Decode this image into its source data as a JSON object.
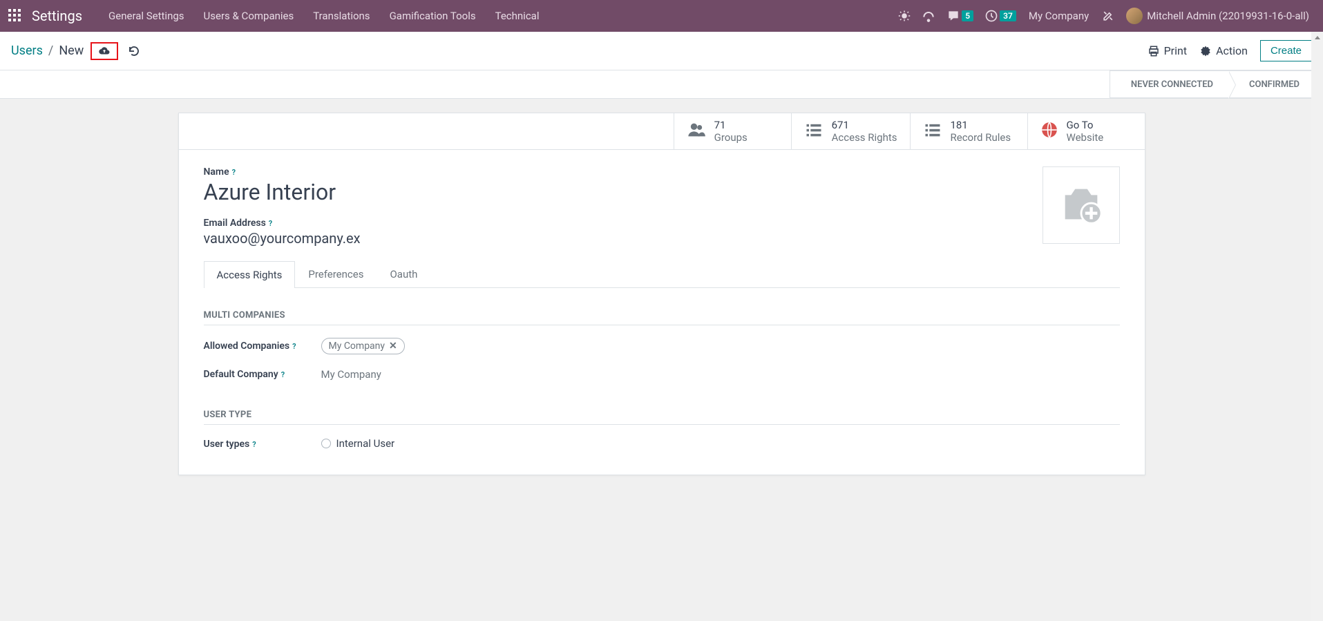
{
  "topbar": {
    "brand": "Settings",
    "nav": [
      "General Settings",
      "Users & Companies",
      "Translations",
      "Gamification Tools",
      "Technical"
    ],
    "messages_badge": "5",
    "activities_badge": "37",
    "company": "My Company",
    "user": "Mitchell Admin (22019931-16-0-all)"
  },
  "breadcrumb": {
    "root": "Users",
    "current": "New"
  },
  "controlbar": {
    "print": "Print",
    "action": "Action",
    "create": "Create"
  },
  "status": {
    "never_connected": "NEVER CONNECTED",
    "confirmed": "CONFIRMED"
  },
  "stats": {
    "groups": {
      "value": "71",
      "label": "Groups"
    },
    "access": {
      "value": "671",
      "label": "Access Rights"
    },
    "rules": {
      "value": "181",
      "label": "Record Rules"
    },
    "website": {
      "line1": "Go To",
      "line2": "Website"
    }
  },
  "form": {
    "name_label": "Name",
    "name_value": "Azure Interior",
    "email_label": "Email Address",
    "email_value": "vauxoo@yourcompany.ex",
    "tabs": {
      "access": "Access Rights",
      "prefs": "Preferences",
      "oauth": "Oauth"
    },
    "sections": {
      "multi_companies": "MULTI COMPANIES",
      "allowed_label": "Allowed Companies",
      "allowed_tag": "My Company",
      "default_label": "Default Company",
      "default_value": "My Company",
      "user_type": "USER TYPE",
      "user_types_label": "User types",
      "internal_user": "Internal User"
    },
    "help_mark": "?"
  }
}
